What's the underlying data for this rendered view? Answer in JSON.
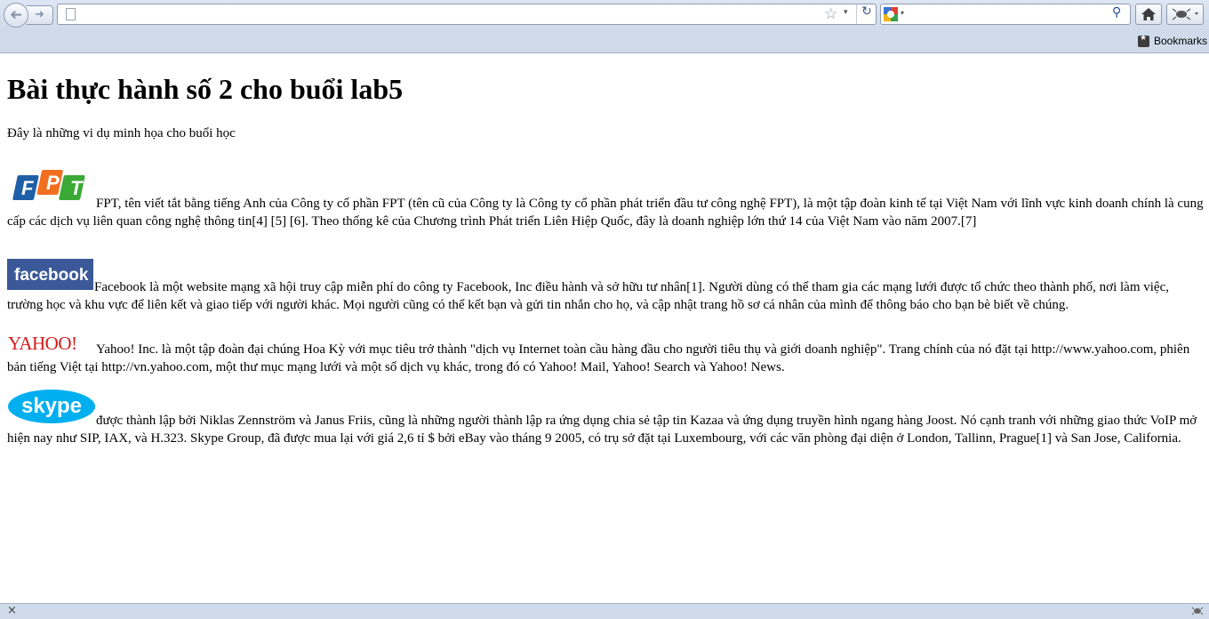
{
  "browser": {
    "url": "",
    "search_placeholder": "",
    "bookmarks_label": "Bookmarks",
    "icons": {
      "back": "back-arrow-icon",
      "forward": "forward-arrow-icon",
      "page": "blank-page-icon",
      "star": "bookmark-star-icon",
      "reload": "reload-icon",
      "search_engine": "google-icon",
      "search": "magnifier-icon",
      "home": "home-icon",
      "addon": "addon-bug-icon",
      "status_close": "close-icon"
    }
  },
  "page": {
    "title": "Bài thực hành số 2 cho buổi lab5",
    "intro": "Đây là những vi dụ minh họa cho buổi học",
    "entries": [
      {
        "logo": "FPT",
        "text": "FPT, tên viết tắt bằng tiếng Anh của Công ty cổ phần FPT (tên cũ của Công ty là Công ty cổ phần phát triển đầu tư công nghệ FPT), là một tập đoàn kinh tế tại Việt Nam với lĩnh vực kinh doanh chính là cung cấp các dịch vụ liên quan công nghệ thông tin[4] [5] [6]. Theo thống kê của Chương trình Phát triển Liên Hiệp Quốc, đây là doanh nghiệp lớn thứ 14 của Việt Nam vào năm 2007.[7]"
      },
      {
        "logo": "facebook",
        "text": "Facebook là một website mạng xã hội truy cập miễn phí do công ty Facebook, Inc điều hành và sở hữu tư nhân[1]. Người dùng có thể tham gia các mạng lưới được tổ chức theo thành phố, nơi làm việc, trường học và khu vực để liên kết và giao tiếp với người khác. Mọi người cũng có thể kết bạn và gửi tin nhắn cho họ, và cập nhật trang hồ sơ cá nhân của mình để thông báo cho bạn bè biết về chúng."
      },
      {
        "logo": "YAHOO!",
        "text": "Yahoo! Inc. là một tập đoàn đại chúng Hoa Kỳ với mục tiêu trở thành \"dịch vụ Internet toàn cầu hàng đầu cho người tiêu thụ và giới doanh nghiệp\". Trang chính của nó đặt tại http://www.yahoo.com, phiên bản tiếng Việt tại http://vn.yahoo.com, một thư mục mạng lưới và một số dịch vụ khác, trong đó có Yahoo! Mail, Yahoo! Search và Yahoo! News."
      },
      {
        "logo": "skype",
        "text": "được thành lập bởi Niklas Zennström và Janus Friis, cũng là những người thành lập ra ứng dụng chia sẻ tập tin Kazaa và ứng dụng truyền hình ngang hàng Joost. Nó cạnh tranh với những giao thức VoIP mở hiện nay như SIP, IAX, và H.323. Skype Group, đã được mua lại với giá 2,6 tỉ $ bởi eBay vào tháng 9 2005, có trụ sở đặt tại Luxembourg, với các văn phòng đại diện ở London, Tallinn, Prague[1] và San Jose, California."
      }
    ]
  },
  "colors": {
    "chrome": "#cfdbea",
    "fpt_orange": "#f26f21",
    "fpt_blue": "#1f5fa8",
    "fpt_green": "#3aa935",
    "facebook_blue": "#3b5998",
    "yahoo_red": "#d21a1a",
    "skype_blue": "#00aff0"
  }
}
